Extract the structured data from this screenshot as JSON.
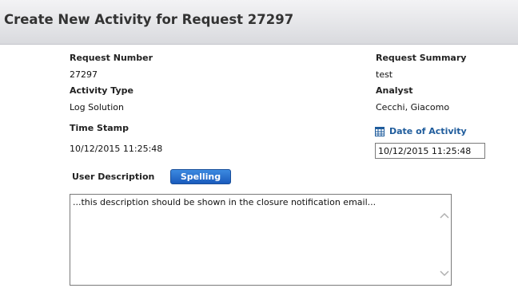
{
  "header": {
    "title": "Create New Activity for Request 27297"
  },
  "fields": {
    "request_number_label": "Request Number",
    "request_number_value": "27297",
    "activity_type_label": "Activity Type",
    "activity_type_value": "Log Solution",
    "time_stamp_label": "Time Stamp",
    "time_stamp_value": "10/12/2015 11:25:48",
    "request_summary_label": "Request Summary",
    "request_summary_value": "test",
    "analyst_label": "Analyst",
    "analyst_value": "Cecchi, Giacomo",
    "date_of_activity_label": "Date of Activity",
    "date_of_activity_value": "10/12/2015 11:25:48",
    "date_icon": "calendar-icon"
  },
  "description": {
    "label": "User Description",
    "spelling_button": "Spelling",
    "text": "...this description should be shown in the closure notification email..."
  },
  "colors": {
    "link": "#1f5c9c",
    "button": "#1a5bbd"
  }
}
